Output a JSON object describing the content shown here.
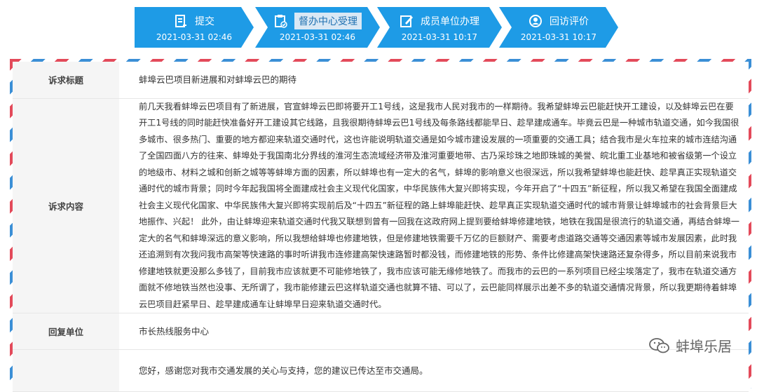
{
  "steps": [
    {
      "label": "提交",
      "time": "2021-03-31 02:46",
      "icon": "submit-icon"
    },
    {
      "label": "督办中心受理",
      "time": "2021-03-31 02:46",
      "icon": "supervise-icon"
    },
    {
      "label": "成员单位办理",
      "time": "2021-03-31 10:17",
      "icon": "handle-icon"
    },
    {
      "label": "回访评价",
      "time": "2021-03-31 10:17",
      "icon": "feedback-icon"
    }
  ],
  "rows": {
    "title_head": "诉求标题",
    "title_value": "蚌埠云巴项目新进展和对蚌埠云巴的期待",
    "content_head": "诉求内容",
    "content_value": "前几天我看蚌埠云巴项目有了新进展，官宣蚌埠云巴即将要开工1号线，这是我市人民对我市的一样期待。我希望蚌埠云巴能赶快开工建设，以及蚌埠云巴在要开工1号线的同时能赶快准备好开工建设其它线路，且我很期待蚌埠云巴1号线及每条路线都能早日、趁早建成通车。毕竟云巴是一种城市轨道交通，如今我国很多城市、很多热门、重要的地方都迎来轨道交通时代，这也许能说明轨道交通是如今城市建设发展的一项重要的交通工具；结合我市是火车拉来的城市连结沟通了全国四面八方的往来、蚌埠处于我国南北分界线的淮河生态流域经济带及淮河重要地带、古乃采珍珠之地即珠城的美誉、皖北重工业基地和被省级第一个设立的地级市、材料之城和创新之城等等蚌埠方面的因素，所以蚌埠也有一定大的名气，蚌埠的影响意义也很深远，所以我希望蚌埠也能赶快、趁早真正实现轨道交通时代的城市背景；同时今年起我国将全面建成社会主义现代化国家，中华民族伟大复兴即将实现，今年开启了“十四五”新征程，所以我又希望在我国全面建成社会主义现代化国家、中华民族伟大复兴即将实现前后及“十四五”新征程的路上蚌埠能赶快、趁早真正实现轨道交通时代的城市背景让蚌埠城市的社会背景巨大地振作、兴起！ 此外，由让蚌埠迎来轨道交通时代我又联想到曾有一回我在这政府网上提到要给蚌埠修建地铁，地铁在我国是很流行的轨道交通，再结合蚌埠一定大的名气和蚌埠深远的意义影响，所以我想给蚌埠也修建地铁，但是修建地铁需要千万亿的巨额财产、需要考虑道路交通等交通因素等城市发展因素，此时我还追溯到有次我问我市高架等快速路的事时听讲我市连修建高架快速路暂时都没钱，而修建地铁的形势、条件比修建高架快速路还复杂得多，所以目前来说我市修建地铁就更没那么多钱了，目前我市应该就更不可能修地铁了，我市应该可能无缘修地铁了。而我市的云巴的一系列项目已经尘埃落定了，我市在轨道交通方面就不修地铁当然也没事、无所谓了，我市能修建云巴这样轨道交通也就算不错、可以了，云巴能同样展示出差不多的轨道交通情况背景，所以我更期待着蚌埠云巴项目赶紧早日、趁早建成通车让蚌埠早日迎来轨道交通时代。",
    "unit_head": "回复单位",
    "unit_value": "市长热线服务中心",
    "reply_value": "您好，感谢您对我市交通发展的关心与支持，您的建议已传达至市交通局。"
  },
  "watermark": "蚌埠乐居",
  "colors": {
    "step_bg": "#1e9be6",
    "stripe_red": "#e34a5a",
    "stripe_blue": "#3b8fd6"
  }
}
